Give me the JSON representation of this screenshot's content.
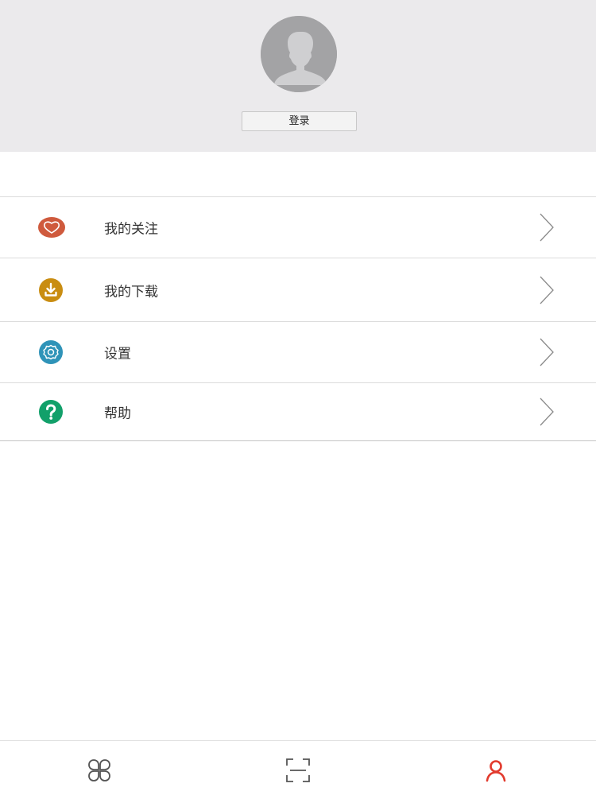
{
  "profile": {
    "avatar_icon": "default-user-avatar-icon",
    "login_label": "登录"
  },
  "menu": {
    "items": [
      {
        "label": "我的关注",
        "icon": "heart-icon",
        "color": "#cf5a3d"
      },
      {
        "label": "我的下载",
        "icon": "download-icon",
        "color": "#c98d12"
      },
      {
        "label": "设置",
        "icon": "gear-icon",
        "color": "#2f93b8"
      },
      {
        "label": "帮助",
        "icon": "help-icon",
        "color": "#12a06a"
      }
    ]
  },
  "tab_bar": {
    "tabs": [
      {
        "icon": "grid-icon",
        "active": false
      },
      {
        "icon": "scan-icon",
        "active": false
      },
      {
        "icon": "user-icon",
        "active": true
      }
    ],
    "active_color": "#e23b2e",
    "inactive_color": "#555555"
  }
}
